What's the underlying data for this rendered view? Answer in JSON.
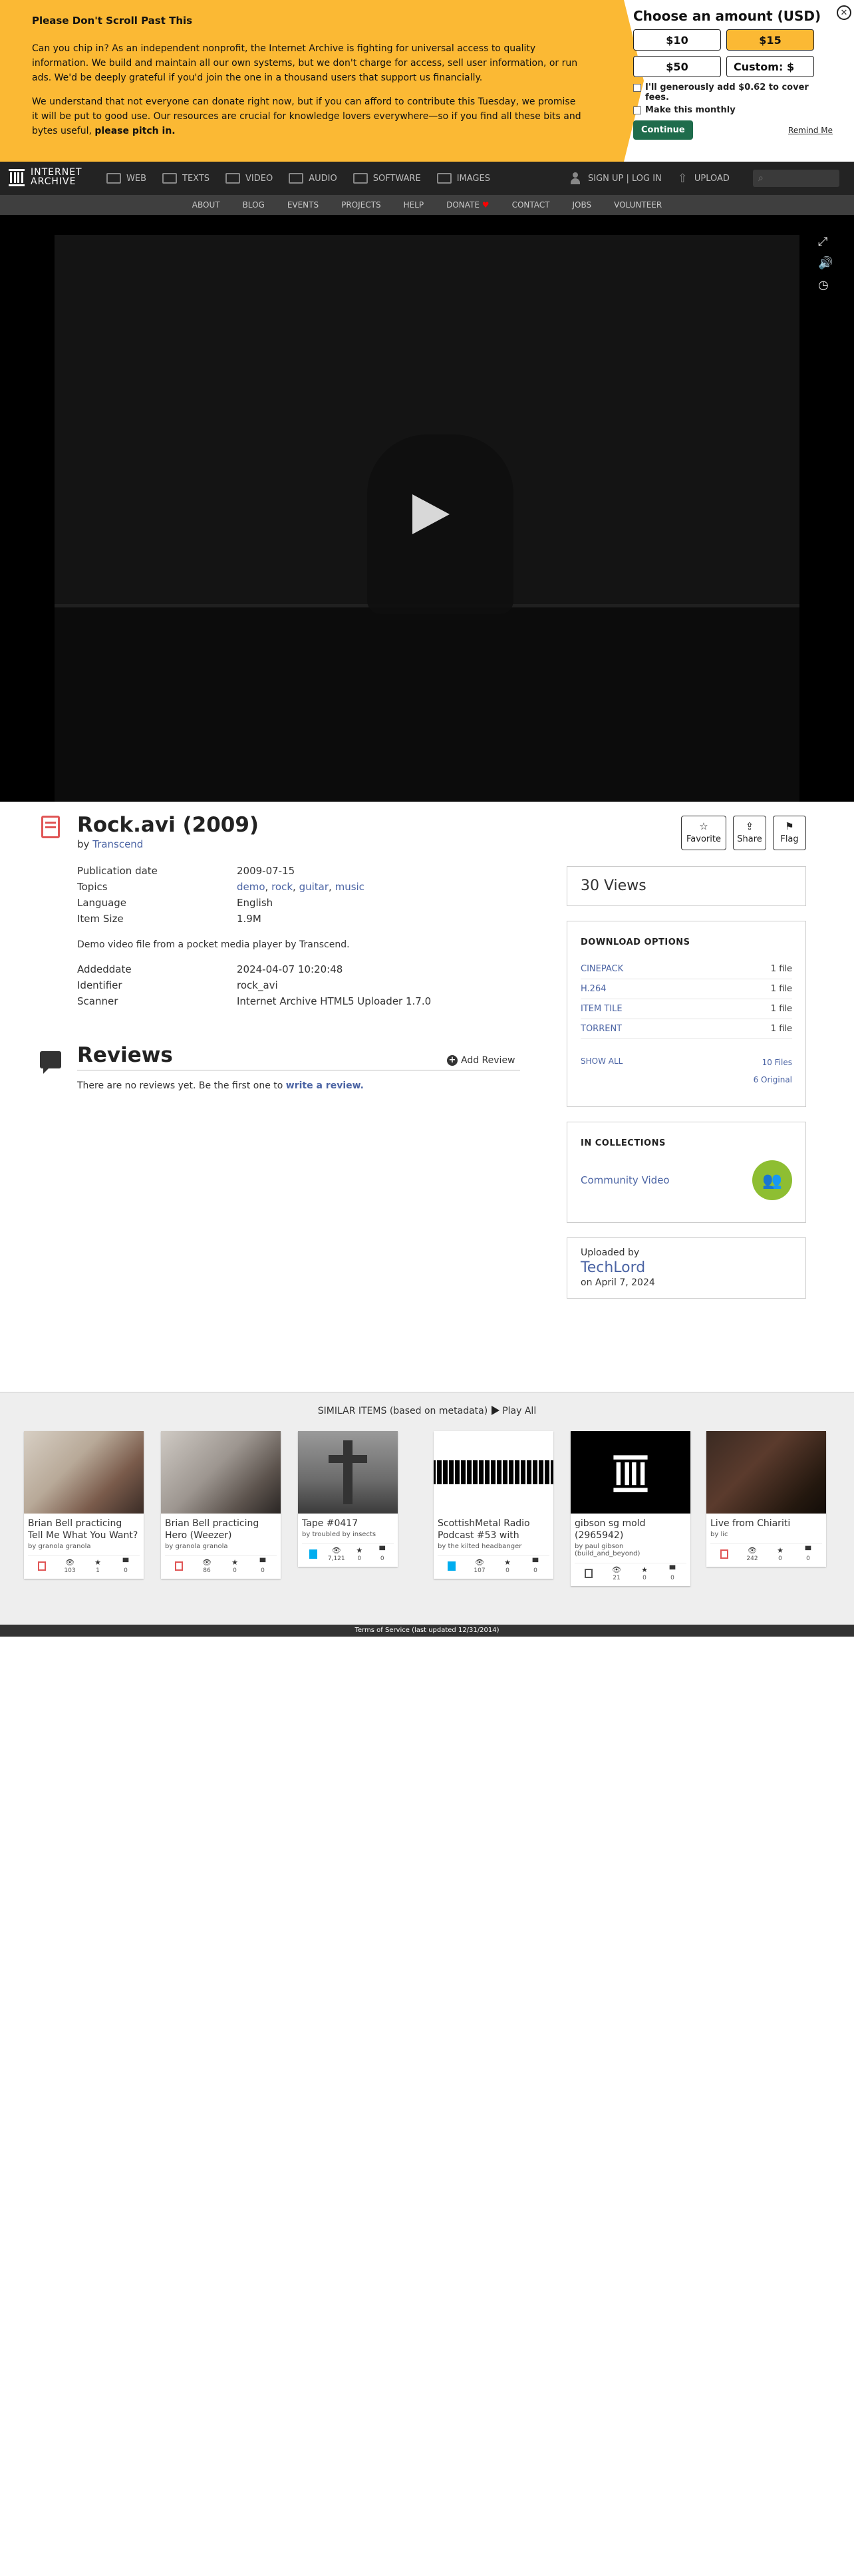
{
  "banner": {
    "title": "Please Don't Scroll Past This",
    "p1": "Can you chip in? As an independent nonprofit, the Internet Archive is fighting for universal access to quality information. We build and maintain all our own systems, but we don't charge for access, sell user information, or run ads. We'd be deeply grateful if you'd join the one in a thousand users that support us financially.",
    "p2": "We understand that not everyone can donate right now, but if you can afford to contribute this Tuesday, we promise it will be put to good use. Our resources are crucial for knowledge lovers everywhere—so if you find all these bits and bytes useful,",
    "p2_bold": "please pitch in.",
    "panel_title": "Choose an amount (USD)",
    "amounts": [
      "$10",
      "$15",
      "$50",
      "Custom: $"
    ],
    "cover_fees": "I'll generously add $0.62 to cover fees.",
    "monthly": "Make this monthly",
    "continue": "Continue",
    "remind": "Remind Me",
    "colors": {
      "background": "#fbb934",
      "continue": "#1f6c4c"
    }
  },
  "topnav": {
    "logo_line1": "INTERNET",
    "logo_line2": "ARCHIVE",
    "items": [
      "WEB",
      "TEXTS",
      "VIDEO",
      "AUDIO",
      "SOFTWARE",
      "IMAGES"
    ],
    "signup": "SIGN UP | LOG IN",
    "upload": "UPLOAD",
    "search_icon": "search-icon"
  },
  "subnav": [
    "ABOUT",
    "BLOG",
    "EVENTS",
    "PROJECTS",
    "HELP",
    "DONATE",
    "CONTACT",
    "JOBS",
    "VOLUNTEER"
  ],
  "item": {
    "title": "Rock.avi (2009)",
    "by_prefix": "by",
    "creator": "Transcend",
    "actions": {
      "favorite": "Favorite",
      "share": "Share",
      "flag": "Flag"
    },
    "meta": {
      "publication_label": "Publication date",
      "publication_value": "2009-07-15",
      "topics_label": "Topics",
      "topics": [
        "demo",
        "rock",
        "guitar",
        "music"
      ],
      "language_label": "Language",
      "language_value": "English",
      "size_label": "Item Size",
      "size_value": "1.9M"
    },
    "description": "Demo video file from a pocket media player by Transcend.",
    "meta2": {
      "added_label": "Addeddate",
      "added_value": "2024-04-07 10:20:48",
      "identifier_label": "Identifier",
      "identifier_value": "rock_avi",
      "scanner_label": "Scanner",
      "scanner_value": "Internet Archive HTML5 Uploader 1.7.0"
    }
  },
  "reviews": {
    "title": "Reviews",
    "add": "Add Review",
    "empty_text": "There are no reviews yet. Be the first one to",
    "empty_link": "write a review."
  },
  "sidebar": {
    "views": "30 Views",
    "downloads_title": "DOWNLOAD OPTIONS",
    "downloads": [
      {
        "name": "CINEPACK",
        "count": "1 file"
      },
      {
        "name": "H.264",
        "count": "1 file"
      },
      {
        "name": "ITEM TILE",
        "count": "1 file"
      },
      {
        "name": "TORRENT",
        "count": "1 file"
      }
    ],
    "show_all": "SHOW ALL",
    "files": "10 Files",
    "original": "6 Original",
    "collections_title": "IN COLLECTIONS",
    "collection": "Community Video",
    "uploaded_by": "Uploaded by",
    "uploader": "TechLord",
    "uploaded_on": "on April 7, 2024"
  },
  "similar": {
    "heading": "SIMILAR ITEMS (based on metadata)",
    "play_all": "Play All",
    "tiles": [
      {
        "title": "Brian Bell practicing Tell Me What You Want?",
        "by": "by granola granola",
        "views": "103",
        "favs": "1",
        "reviews": "0",
        "type": "movies"
      },
      {
        "title": "Brian Bell practicing Hero (Weezer)",
        "by": "by granola granola",
        "views": "86",
        "favs": "0",
        "reviews": "0",
        "type": "movies"
      },
      {
        "title": "Tape #0417",
        "by": "by troubled by insects",
        "views": "7,121",
        "favs": "0",
        "reviews": "0",
        "type": "audio"
      },
      {
        "title": "ScottishMetal Radio Podcast #53 with",
        "by": "by the kilted headbanger",
        "views": "107",
        "favs": "0",
        "reviews": "0",
        "type": "audio"
      },
      {
        "title": "gibson sg mold (2965942)",
        "by": "by paul gibson (build_and_beyond)",
        "views": "21",
        "favs": "0",
        "reviews": "0",
        "type": "data"
      },
      {
        "title": "Live from Chiariti",
        "by": "by lic",
        "views": "242",
        "favs": "0",
        "reviews": "0",
        "type": "movies"
      }
    ]
  },
  "footer": "Terms of Service (last updated 12/31/2014)"
}
